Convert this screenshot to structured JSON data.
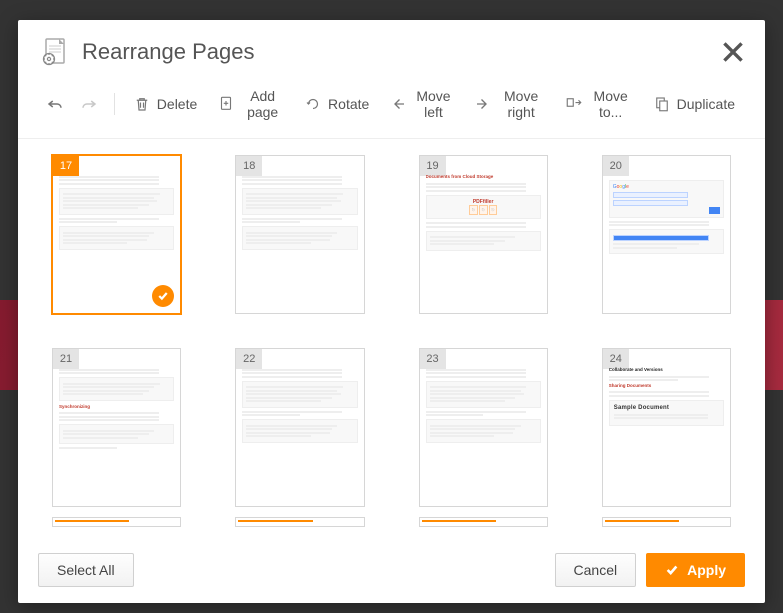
{
  "header": {
    "title": "Rearrange Pages"
  },
  "toolbar": {
    "delete": "Delete",
    "add_page": "Add page",
    "rotate": "Rotate",
    "move_left": "Move left",
    "move_right": "Move right",
    "move_to": "Move to...",
    "duplicate": "Duplicate"
  },
  "pages": [
    {
      "num": "17",
      "selected": true,
      "content": {
        "heading": "",
        "style": "doc-ui"
      }
    },
    {
      "num": "18",
      "selected": false,
      "content": {
        "heading": "",
        "style": "doc-ui"
      }
    },
    {
      "num": "19",
      "selected": false,
      "content": {
        "heading": "Documents from Cloud Storage",
        "style": "cloud"
      }
    },
    {
      "num": "20",
      "selected": false,
      "content": {
        "heading": "",
        "style": "google"
      }
    },
    {
      "num": "21",
      "selected": false,
      "content": {
        "heading": "Synchronizing",
        "style": "sync"
      }
    },
    {
      "num": "22",
      "selected": false,
      "content": {
        "heading": "",
        "style": "doc-ui"
      }
    },
    {
      "num": "23",
      "selected": false,
      "content": {
        "heading": "",
        "style": "doc-ui"
      }
    },
    {
      "num": "24",
      "selected": false,
      "content": {
        "heading": "Collaborate and Versions",
        "subheading": "Sharing Documents",
        "sample": "Sample Document",
        "style": "collab"
      }
    }
  ],
  "footer": {
    "select_all": "Select All",
    "cancel": "Cancel",
    "apply": "Apply"
  }
}
